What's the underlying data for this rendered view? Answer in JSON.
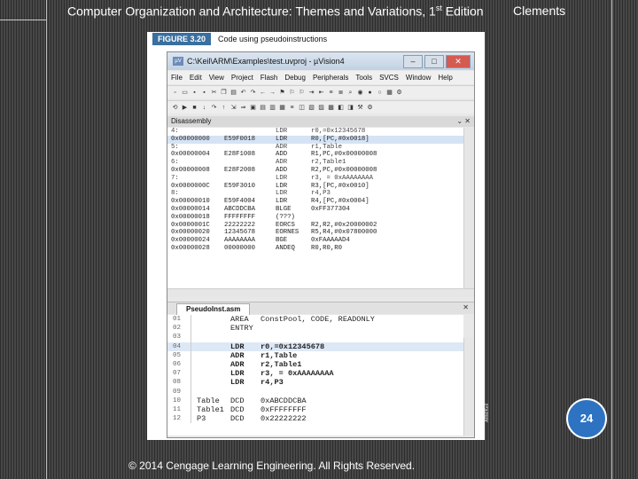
{
  "slide": {
    "title_main": "Computer Organization and Architecture: Themes and Variations, 1",
    "title_sup": "st",
    "title_end": " Edition",
    "author": "Clements",
    "page_number": "24",
    "copyright": "© 2014 Cengage Learning Engineering. All Rights Reserved.",
    "credit": "ARM/Keil"
  },
  "figure": {
    "label": "FIGURE 3.20",
    "caption": "Code using pseudoinstructions"
  },
  "window": {
    "title": "C:\\Keil\\ARM\\Examples\\test.uvproj - µVision4",
    "controls": {
      "minimize": "–",
      "maximize": "□",
      "close": "✕"
    }
  },
  "menu": [
    "File",
    "Edit",
    "View",
    "Project",
    "Flash",
    "Debug",
    "Peripherals",
    "Tools",
    "SVCS",
    "Window",
    "Help"
  ],
  "disassembly": {
    "title": "Disassembly",
    "lines": [
      {
        "addr": "4:",
        "hex": "",
        "mn": "LDR",
        "op": "r0,=0x12345678"
      },
      {
        "addr": "0x00000000",
        "hex": "E59F0018",
        "mn": "LDR",
        "op": "R0,[PC,#0x0018]"
      },
      {
        "addr": "5:",
        "hex": "",
        "mn": "ADR",
        "op": "r1,Table"
      },
      {
        "addr": "0x00000004",
        "hex": "E28F1008",
        "mn": "ADD",
        "op": "R1,PC,#0x00000008"
      },
      {
        "addr": "6:",
        "hex": "",
        "mn": "ADR",
        "op": "r2,Table1"
      },
      {
        "addr": "0x00000008",
        "hex": "E28F2008",
        "mn": "ADD",
        "op": "R2,PC,#0x00000008"
      },
      {
        "addr": "7:",
        "hex": "",
        "mn": "LDR",
        "op": "r3, = 0xAAAAAAAA"
      },
      {
        "addr": "0x0000000C",
        "hex": "E59F3010",
        "mn": "LDR",
        "op": "R3,[PC,#0x0010]"
      },
      {
        "addr": "8:",
        "hex": "",
        "mn": "LDR",
        "op": "r4,P3"
      },
      {
        "addr": "0x00000010",
        "hex": "E59F4004",
        "mn": "LDR",
        "op": "R4,[PC,#0x0004]"
      },
      {
        "addr": "0x00000014",
        "hex": "ABCDDCBA",
        "mn": "BLGE",
        "op": "0xFF377304"
      },
      {
        "addr": "0x00000018",
        "hex": "FFFFFFFF",
        "mn": "(???)",
        "op": ""
      },
      {
        "addr": "0x0000001C",
        "hex": "22222222",
        "mn": "EORCS",
        "op": "R2,R2,#0x20000002"
      },
      {
        "addr": "0x00000020",
        "hex": "12345678",
        "mn": "EORNES",
        "op": "R5,R4,#0x07800000"
      },
      {
        "addr": "0x00000024",
        "hex": "AAAAAAAA",
        "mn": "BGE",
        "op": "0xFAAAAAD4"
      },
      {
        "addr": "0x00000028",
        "hex": "00000000",
        "mn": "ANDEQ",
        "op": "R0,R0,R0"
      }
    ]
  },
  "editor": {
    "tab": "PseudoInst.asm",
    "lines": [
      {
        "n": "01",
        "label": "",
        "mn": "AREA",
        "op": "ConstPool, CODE, READONLY",
        "bold": false
      },
      {
        "n": "02",
        "label": "",
        "mn": "ENTRY",
        "op": "",
        "bold": false
      },
      {
        "n": "03",
        "label": "",
        "mn": "",
        "op": "",
        "bold": false
      },
      {
        "n": "04",
        "label": "",
        "mn": "LDR",
        "op": "r0,=0x12345678",
        "bold": true
      },
      {
        "n": "05",
        "label": "",
        "mn": "ADR",
        "op": "r1,Table",
        "bold": true
      },
      {
        "n": "06",
        "label": "",
        "mn": "ADR",
        "op": "r2,Table1",
        "bold": true
      },
      {
        "n": "07",
        "label": "",
        "mn": "LDR",
        "op": "r3, = 0xAAAAAAAA",
        "bold": true
      },
      {
        "n": "08",
        "label": "",
        "mn": "LDR",
        "op": "r4,P3",
        "bold": true
      },
      {
        "n": "09",
        "label": "",
        "mn": "",
        "op": "",
        "bold": false
      },
      {
        "n": "10",
        "label": "Table",
        "mn": "DCD",
        "op": "0xABCDDCBA",
        "bold": false
      },
      {
        "n": "11",
        "label": "Table1",
        "mn": "DCD",
        "op": "0xFFFFFFFF",
        "bold": false
      },
      {
        "n": "12",
        "label": "P3",
        "mn": "DCD",
        "op": "0x22222222",
        "bold": false
      }
    ]
  }
}
